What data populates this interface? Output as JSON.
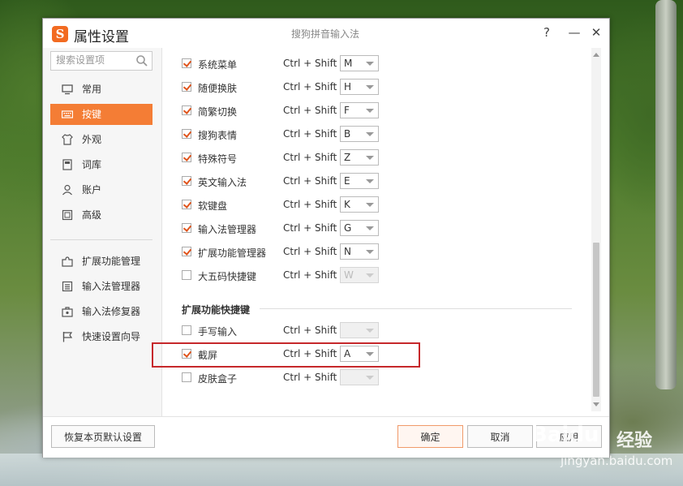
{
  "window": {
    "title": "属性设置",
    "app_name": "搜狗拼音输入法",
    "logo_letter": "S",
    "help": "?",
    "minimize": "—",
    "close": "✕"
  },
  "search": {
    "placeholder": "搜索设置项"
  },
  "sidebar": {
    "items": [
      {
        "label": "常用",
        "icon": "monitor-icon"
      },
      {
        "label": "按键",
        "icon": "keyboard-icon"
      },
      {
        "label": "外观",
        "icon": "shirt-icon"
      },
      {
        "label": "词库",
        "icon": "book-icon"
      },
      {
        "label": "账户",
        "icon": "user-icon"
      },
      {
        "label": "高级",
        "icon": "square-icon"
      }
    ],
    "tools": [
      {
        "label": "扩展功能管理",
        "icon": "puzzle-icon"
      },
      {
        "label": "输入法管理器",
        "icon": "list-icon"
      },
      {
        "label": "输入法修复器",
        "icon": "toolbox-icon"
      },
      {
        "label": "快速设置向导",
        "icon": "flag-icon"
      }
    ]
  },
  "shortcuts": {
    "modifier": "Ctrl + Shift +",
    "rows": [
      {
        "label": "系统菜单",
        "checked": true,
        "key": "M"
      },
      {
        "label": "随便换肤",
        "checked": true,
        "key": "H"
      },
      {
        "label": "简繁切换",
        "checked": true,
        "key": "F"
      },
      {
        "label": "搜狗表情",
        "checked": true,
        "key": "B"
      },
      {
        "label": "特殊符号",
        "checked": true,
        "key": "Z"
      },
      {
        "label": "英文输入法",
        "checked": true,
        "key": "E"
      },
      {
        "label": "软键盘",
        "checked": true,
        "key": "K"
      },
      {
        "label": "输入法管理器",
        "checked": true,
        "key": "G"
      },
      {
        "label": "扩展功能管理器",
        "checked": true,
        "key": "N"
      },
      {
        "label": "大五码快捷键",
        "checked": false,
        "key": "W"
      }
    ]
  },
  "extension": {
    "title": "扩展功能快捷键",
    "rows": [
      {
        "label": "手写输入",
        "checked": false,
        "key": ""
      },
      {
        "label": "截屏",
        "checked": true,
        "key": "A"
      },
      {
        "label": "皮肤盒子",
        "checked": false,
        "key": ""
      }
    ]
  },
  "footer": {
    "restore_label": "恢复本页默认设置",
    "ok_label": "确定",
    "cancel_label": "取消",
    "apply_label": "应用"
  },
  "watermark": {
    "brand": "Baidu",
    "jingyan": "经验",
    "url": "jingyan.baidu.com"
  },
  "colors": {
    "accent": "#f47d35",
    "highlight": "#c6282b",
    "check": "#e0541c"
  }
}
